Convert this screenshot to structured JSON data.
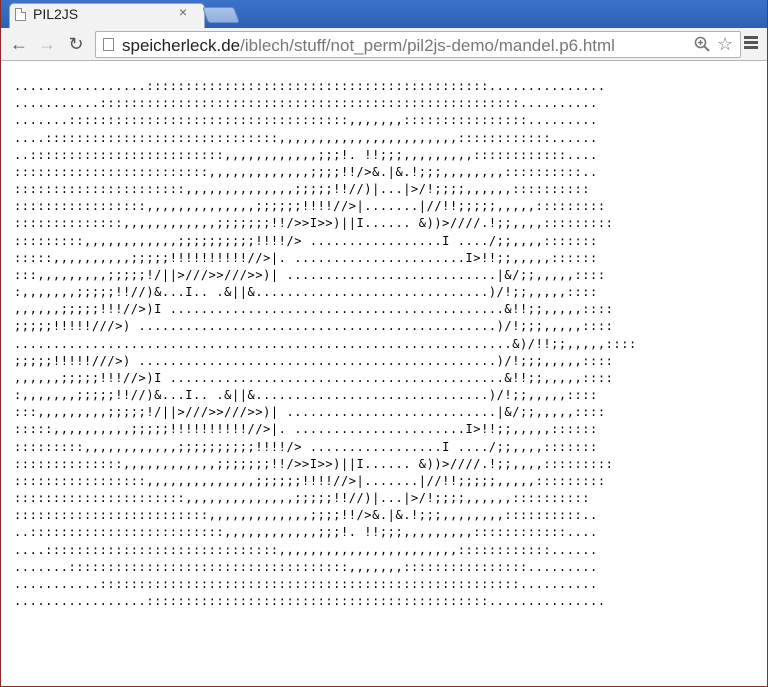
{
  "tab": {
    "title": "PIL2JS",
    "close_label": "×"
  },
  "toolbar": {
    "back": "←",
    "forward": "→",
    "reload": "↻",
    "url_host": "speicherleck.de",
    "url_path": "/iblech/stuff/not_perm/pil2js-demo/mandel.p6.html",
    "star": "☆"
  },
  "mandel": {
    "lines": [
      ".................::::::::::::::::::::::::::::::::::::::::::::...............",
      "...........::::::::::::::::::::::::::::::::::::::::::::::::::::::..........",
      ".......::::::::::::::::::::::::::::::::::::,,,,,,,::::::::::::::::.........",
      "....::::::::::::::::::::::::::::::,,,,,,,,,,,,,,,,,,,,,,,::::::::::::......",
      "..:::::::::::::::::::::::::,,,,,,,,,,,,;;;!. !!;;;,,,,,,,,,::::::::::::....",
      ":::::::::::::::::::::::::,,,,,,,,,,,,,;;;;!!/>&.|&.!;;;,,,,,,,,::::::::::..",
      "::::::::::::::::::::::,,,,,,,,,,,,,,;;;;;!!//)|...|>/!;;;;,,,,,,::::::::::",
      ":::::::::::::::::,,,,,,,,,,,,,,;;;;;;!!!!//>|.......|//!!;;;;;,,,,,:::::::::",
      "::::::::::::::,,,,,,,,,,,,;;;;;;;!!/>>I>>)||I...... &))>////.!;;,,,,:::::::::",
      ":::::::::,,,,,,,,,,,,;;;;;;;;;;!!!!/> .................I ..../;;,,,,:::::::",
      ":::::,,,,,,,,,,;;;;;!!!!!!!!!!//>|. ......................I>!!;;,,,,,::::::",
      ":::,,,,,,,,,;;;;;!/||>///>>///>>)| ...........................|&/;;,,,,,::::",
      ":,,,,,,,;;;;;!!//)&...I.. .&||&..............................)/!;;,,,,,::::",
      ",,,,,,;;;;;!!!//>)I ...........................................&!!;;,,,,,::::",
      ";;;;;!!!!!///>) ..............................................)/!;;;,,,,,::::",
      "................................................................&)/!!;;,,,,,::::",
      ";;;;;!!!!!///>) ..............................................)/!;;;,,,,,::::",
      ",,,,,,;;;;;!!!//>)I ...........................................&!!;;,,,,,::::",
      ":,,,,,,,;;;;;!!//)&...I.. .&||&..............................)/!;;,,,,,::::",
      ":::,,,,,,,,,;;;;;!/||>///>>///>>)| ...........................|&/;;,,,,,::::",
      ":::::,,,,,,,,,,;;;;;!!!!!!!!!!//>|. ......................I>!!;;,,,,,::::::",
      ":::::::::,,,,,,,,,,,,;;;;;;;;;;!!!!/> .................I ..../;;,,,,:::::::",
      "::::::::::::::,,,,,,,,,,,,;;;;;;;!!/>>I>>)||I...... &))>////.!;;,,,,:::::::::",
      ":::::::::::::::::,,,,,,,,,,,,,,;;;;;;!!!!//>|.......|//!!;;;;;,,,,,:::::::::",
      "::::::::::::::::::::::,,,,,,,,,,,,,,;;;;;!!//)|...|>/!;;;;,,,,,,::::::::::",
      ":::::::::::::::::::::::::,,,,,,,,,,,,,;;;;!!/>&.|&.!;;;,,,,,,,,::::::::::..",
      "..:::::::::::::::::::::::::,,,,,,,,,,,,;;;!. !!;;;,,,,,,,,,::::::::::::....",
      "....::::::::::::::::::::::::::::::,,,,,,,,,,,,,,,,,,,,,,,::::::::::::......",
      ".......::::::::::::::::::::::::::::::::::::,,,,,,,::::::::::::::::.........",
      "...........::::::::::::::::::::::::::::::::::::::::::::::::::::::..........",
      ".................::::::::::::::::::::::::::::::::::::::::::::..............."
    ]
  }
}
